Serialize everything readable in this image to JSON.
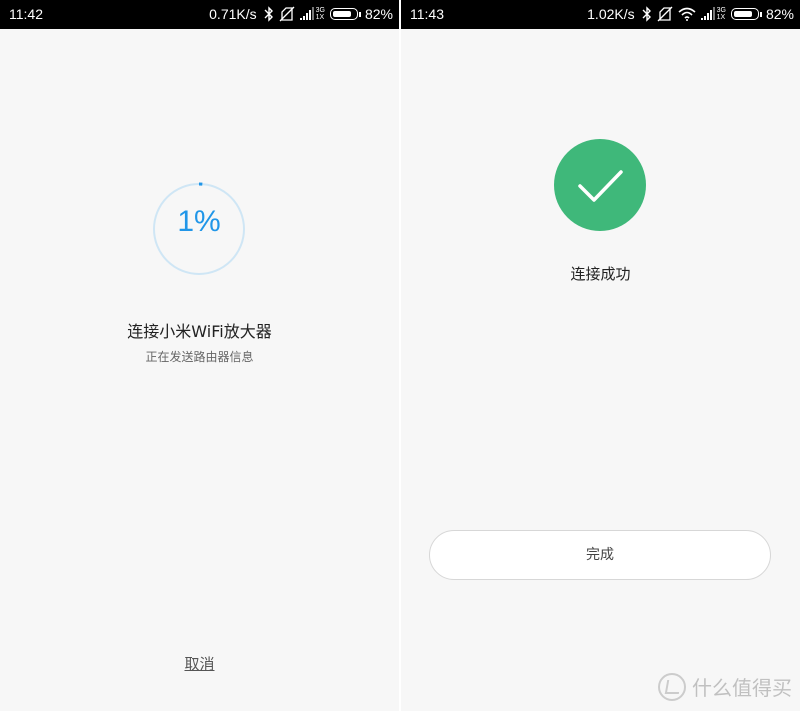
{
  "left": {
    "status": {
      "time": "11:42",
      "speed": "0.71K/s",
      "signal_top": "3G",
      "signal_bottom": "1X",
      "battery": "82%",
      "battery_level": 0.82
    },
    "progress": {
      "text": "1%",
      "value": 0.01
    },
    "title": "连接小米WiFi放大器",
    "subtitle": "正在发送路由器信息",
    "cancel_label": "取消"
  },
  "right": {
    "status": {
      "time": "11:43",
      "speed": "1.02K/s",
      "signal_top": "3G",
      "signal_bottom": "1X",
      "battery": "82%",
      "battery_level": 0.82
    },
    "title": "连接成功",
    "done_label": "完成"
  },
  "watermark": {
    "text": "什么值得买"
  },
  "colors": {
    "accent": "#2196e8",
    "success": "#3fb87a",
    "ring_track": "#cfe6f5"
  },
  "icons": [
    "bluetooth-icon",
    "no-sim-icon",
    "signal-icon",
    "wifi-icon",
    "battery-icon",
    "checkmark-icon",
    "watermark-logo-icon"
  ]
}
